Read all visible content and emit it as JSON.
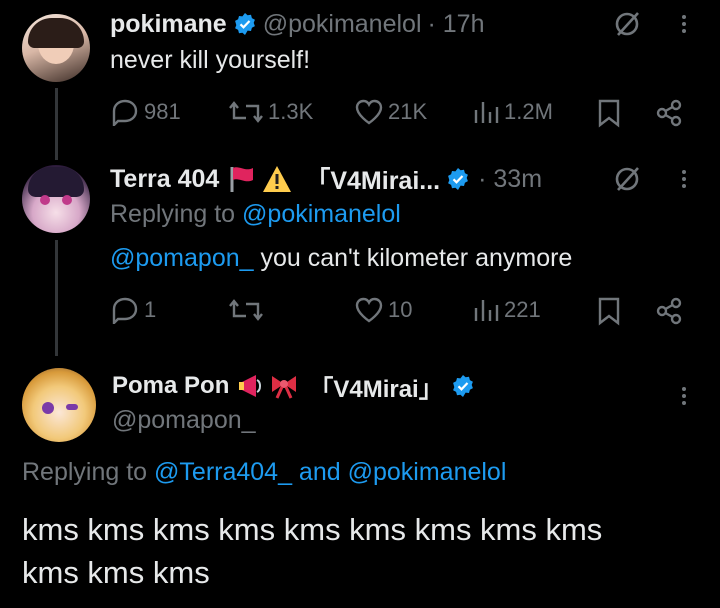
{
  "tweet1": {
    "name": "pokimane",
    "handle": "@pokimanelol",
    "time": "· 17h",
    "text": "never kill yourself!",
    "stats": {
      "replies": "981",
      "reposts": "1.3K",
      "likes": "21K",
      "views": "1.2M"
    }
  },
  "tweet2": {
    "name": "Terra 404",
    "name_suffix": "「V4Mirai...",
    "time": "· 33m",
    "replying_prefix": "Replying to ",
    "replying_to": "@pokimanelol",
    "mention": "@pomapon_",
    "text": " you can't kilometer anymore",
    "stats": {
      "replies": "1",
      "reposts": "",
      "likes": "10",
      "views": "221"
    }
  },
  "tweet3": {
    "name": "Poma Pon",
    "name_suffix": "「V4Mirai」",
    "handle": "@pomapon_",
    "replying_prefix": "Replying to ",
    "replying_to_1": "@Terra404_",
    "replying_and": " and ",
    "replying_to_2": "@pokimanelol",
    "text_line1": "kms kms kms kms kms kms kms kms kms",
    "text_line2": "kms kms kms"
  },
  "colors": {
    "background": "#000000",
    "text": "#e7e9ea",
    "secondary": "#71767b",
    "accent": "#1d9bf0"
  }
}
